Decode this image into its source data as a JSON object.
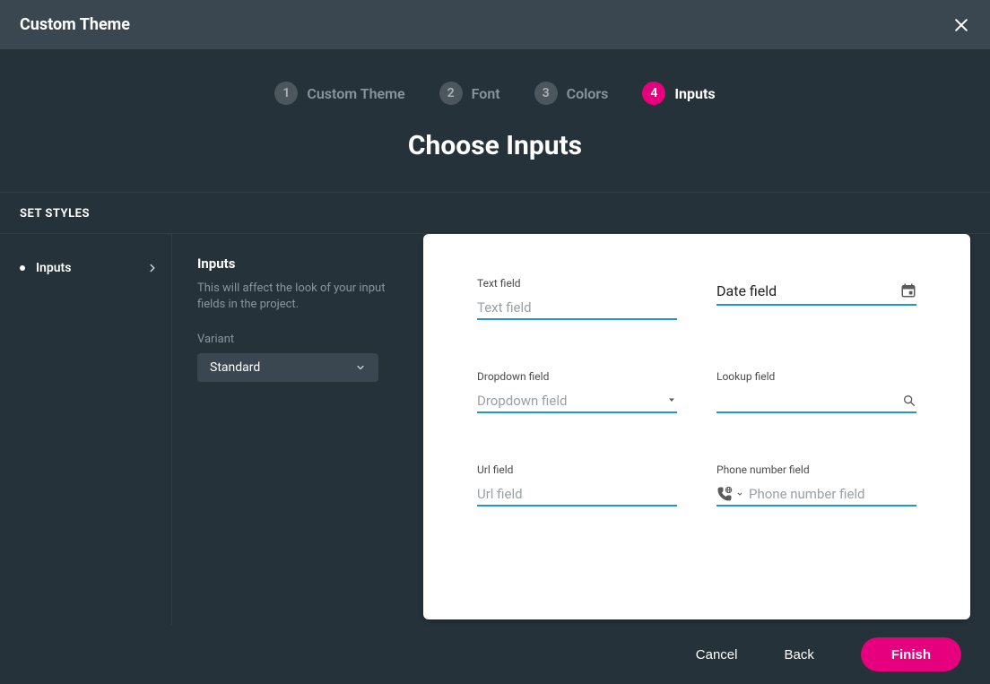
{
  "header": {
    "title": "Custom Theme"
  },
  "stepper": {
    "heading": "Choose Inputs",
    "steps": [
      {
        "num": "1",
        "label": "Custom Theme",
        "active": false
      },
      {
        "num": "2",
        "label": "Font",
        "active": false
      },
      {
        "num": "3",
        "label": "Colors",
        "active": false
      },
      {
        "num": "4",
        "label": "Inputs",
        "active": true
      }
    ]
  },
  "section_bar": "SET STYLES",
  "sidebar": {
    "items": [
      {
        "label": "Inputs"
      }
    ]
  },
  "config": {
    "title": "Inputs",
    "description": "This will affect the look of your input fields in the project.",
    "variant_label": "Variant",
    "variant_value": "Standard"
  },
  "preview": {
    "fields": {
      "text": {
        "label": "Text field",
        "placeholder": "Text field"
      },
      "date": {
        "label": "Date field",
        "value": "Date field"
      },
      "dropdown": {
        "label": "Dropdown field",
        "placeholder": "Dropdown field"
      },
      "lookup": {
        "label": "Lookup field",
        "placeholder": ""
      },
      "url": {
        "label": "Url field",
        "placeholder": "Url field"
      },
      "phone": {
        "label": "Phone number field",
        "placeholder": "Phone number field"
      }
    }
  },
  "footer": {
    "cancel": "Cancel",
    "back": "Back",
    "finish": "Finish"
  },
  "colors": {
    "accent": "#e6007e",
    "input_underline": "#2196c9"
  }
}
